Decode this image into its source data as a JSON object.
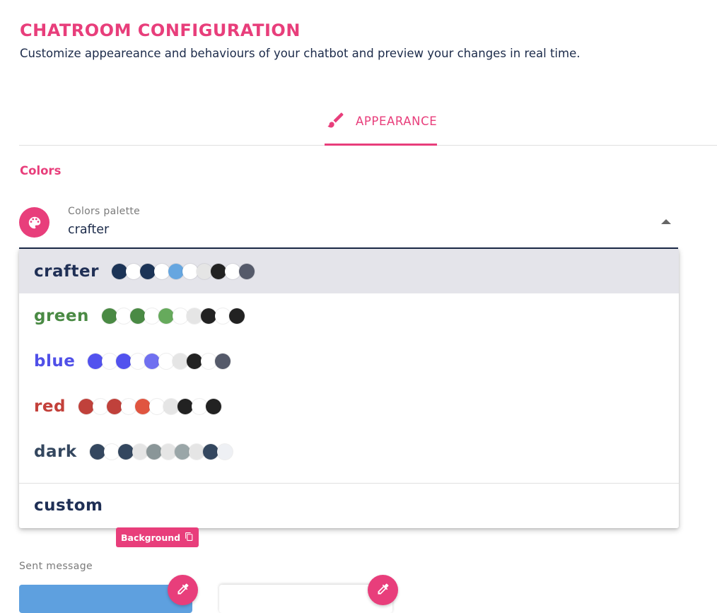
{
  "header": {
    "title": "CHATROOM CONFIGURATION",
    "subtitle": "Customize appeareance and behaviours of your chatbot and preview your changes in real time."
  },
  "tabs": [
    {
      "label": "APPEARANCE",
      "icon": "brush-icon",
      "active": true
    }
  ],
  "section": {
    "title": "Colors"
  },
  "palette_field": {
    "label": "Colors palette",
    "value": "crafter",
    "icon": "palette-icon"
  },
  "palettes": [
    {
      "name": "crafter",
      "name_color": "#1f2f55",
      "selected": true,
      "swatches": [
        "#1b3356",
        "#ffffff",
        "#1b3356",
        "#ffffff",
        "#66a6e0",
        "#ffffff",
        "#e5e5e5",
        "#222222",
        "#ffffff",
        "#555a6a"
      ]
    },
    {
      "name": "green",
      "name_color": "#4a8a44",
      "selected": false,
      "swatches": [
        "#4a8a44",
        "#ffffff",
        "#4a8a44",
        "#ffffff",
        "#66aa5c",
        "#ffffff",
        "#e5e5e5",
        "#222222",
        "#ffffff",
        "#222222"
      ]
    },
    {
      "name": "blue",
      "name_color": "#5050e8",
      "selected": false,
      "swatches": [
        "#5252ee",
        "#ffffff",
        "#5252ee",
        "#ffffff",
        "#7070f0",
        "#ffffff",
        "#e5e5e5",
        "#222222",
        "#ffffff",
        "#555a6a"
      ]
    },
    {
      "name": "red",
      "name_color": "#c3403a",
      "selected": false,
      "swatches": [
        "#c0413b",
        "#ffffff",
        "#c0413b",
        "#ffffff",
        "#e05540",
        "#ffffff",
        "#e5e5e5",
        "#222222",
        "#ffffff",
        "#222222"
      ]
    },
    {
      "name": "dark",
      "name_color": "#34475f",
      "selected": false,
      "swatches": [
        "#34475f",
        "#ffffff",
        "#34475f",
        "#e5e5e5",
        "#8a9698",
        "#e5e5e5",
        "#9aa6a8",
        "#e5e5e5",
        "#34475f",
        "#eef0f4"
      ]
    }
  ],
  "custom_option": {
    "name": "custom",
    "name_color": "#1f2f55"
  },
  "background_chip": {
    "label": "Background",
    "icon": "copy-icon"
  },
  "sent_message": {
    "label": "Sent message"
  },
  "colors": {
    "accent": "#e83e7b",
    "text": "#1c2b4a"
  }
}
